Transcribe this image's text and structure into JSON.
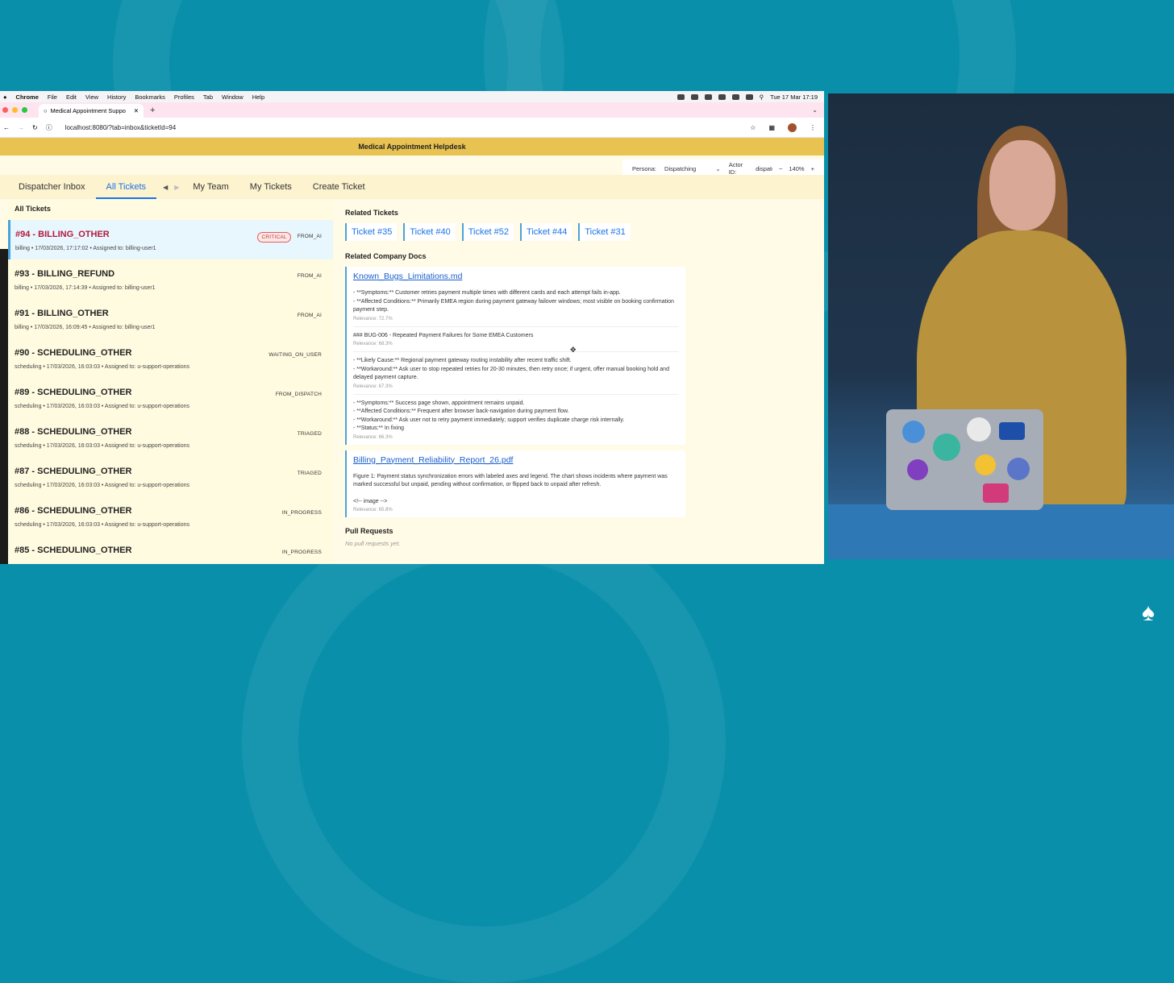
{
  "macos_menubar": {
    "app_name": "Chrome",
    "menus": [
      "File",
      "Edit",
      "View",
      "History",
      "Bookmarks",
      "Profiles",
      "Tab",
      "Window",
      "Help"
    ],
    "clock": "Tue 17 Mar  17:19"
  },
  "browser": {
    "tab_title": "Medical Appointment Suppo",
    "url": "localhost:8080/?tab=inbox&ticketId=94"
  },
  "app": {
    "header_title": "Medical Appointment Helpdesk",
    "persona": {
      "label": "Persona:",
      "value": "Dispatching",
      "actor_label": "Actor ID:",
      "actor_value": "dispatcher",
      "zoom_minus": "−",
      "zoom": "140%",
      "zoom_plus": "+"
    },
    "nav": {
      "tabs": [
        "Dispatcher Inbox",
        "All Tickets"
      ],
      "more_tabs": [
        "My Team",
        "My Tickets",
        "Create Ticket"
      ],
      "active": "All Tickets"
    },
    "list": {
      "heading": "All Tickets",
      "tickets": [
        {
          "title": "#94 - BILLING_OTHER",
          "meta": "billing • 17/03/2026, 17:17:02 • Assigned to: billing-user1",
          "badges": [
            "CRITICAL",
            "FROM_AI"
          ],
          "selected": true
        },
        {
          "title": "#93 - BILLING_REFUND",
          "meta": "billing • 17/03/2026, 17:14:39 • Assigned to: billing-user1",
          "badges": [
            "FROM_AI"
          ]
        },
        {
          "title": "#91 - BILLING_OTHER",
          "meta": "billing • 17/03/2026, 16:09:45 • Assigned to: billing-user1",
          "badges": [
            "FROM_AI"
          ]
        },
        {
          "title": "#90 - SCHEDULING_OTHER",
          "meta": "scheduling • 17/03/2026, 16:03:03 • Assigned to: u-support-operations",
          "badges": [
            "WAITING_ON_USER"
          ]
        },
        {
          "title": "#89 - SCHEDULING_OTHER",
          "meta": "scheduling • 17/03/2026, 16:03:03 • Assigned to: u-support-operations",
          "badges": [
            "FROM_DISPATCH"
          ]
        },
        {
          "title": "#88 - SCHEDULING_OTHER",
          "meta": "scheduling • 17/03/2026, 16:03:03 • Assigned to: u-support-operations",
          "badges": [
            "TRIAGED"
          ]
        },
        {
          "title": "#87 - SCHEDULING_OTHER",
          "meta": "scheduling • 17/03/2026, 16:03:03 • Assigned to: u-support-operations",
          "badges": [
            "TRIAGED"
          ]
        },
        {
          "title": "#86 - SCHEDULING_OTHER",
          "meta": "scheduling • 17/03/2026, 16:03:03 • Assigned to: u-support-operations",
          "badges": [
            "IN_PROGRESS"
          ]
        },
        {
          "title": "#85 - SCHEDULING_OTHER",
          "meta": "",
          "badges": [
            "IN_PROGRESS"
          ]
        }
      ]
    },
    "detail": {
      "related_tickets_heading": "Related Tickets",
      "related_tickets": [
        "Ticket #35",
        "Ticket #40",
        "Ticket #52",
        "Ticket #44",
        "Ticket #31"
      ],
      "docs_heading": "Related Company Docs",
      "docs": [
        {
          "title": "Known_Bugs_Limitations.md",
          "snippets": [
            {
              "lines": [
                "- **Symptoms:** Customer retries payment multiple times with different cards and each attempt fails in-app.",
                "- **Affected Conditions:** Primarily EMEA region during payment gateway failover windows; most visible on booking confirmation payment step."
              ],
              "relevance": "Relevance: 72.7%"
            },
            {
              "lines": [
                "### BUG-006 - Repeated Payment Failures for Some EMEA Customers"
              ],
              "relevance": "Relevance: 68.3%"
            },
            {
              "lines": [
                "- **Likely Cause:** Regional payment gateway routing instability after recent traffic shift.",
                "- **Workaround:** Ask user to stop repeated retries for 20-30 minutes, then retry once; if urgent, offer manual booking hold and delayed payment capture."
              ],
              "relevance": "Relevance: 67.3%"
            },
            {
              "lines": [
                "- **Symptoms:** Success page shown, appointment remains unpaid.",
                "- **Affected Conditions:** Frequent after browser back-navigation during payment flow.",
                "- **Workaround:** Ask user not to retry payment immediately; support verifies duplicate charge risk internally.",
                "- **Status:** In fixing"
              ],
              "relevance": "Relevance: 66.3%"
            }
          ]
        },
        {
          "title": "Billing_Payment_Reliability_Report_26.pdf",
          "snippets": [
            {
              "lines": [
                "Figure 1: Payment status synchronization errors with labeled axes and legend. The chart shows incidents where payment was marked successful but unpaid, pending without confirmation, or flipped back to unpaid after refresh."
              ],
              "relevance": ""
            },
            {
              "lines": [
                "<!-- image -->"
              ],
              "relevance": "Relevance: 65.8%"
            }
          ]
        }
      ],
      "pr_heading": "Pull Requests",
      "pr_empty": "No pull requests yet."
    }
  },
  "colors": {
    "backdrop": "#0a8fab",
    "app_header": "#e8c352",
    "link": "#1a73e8",
    "critical": "#b3193f"
  }
}
